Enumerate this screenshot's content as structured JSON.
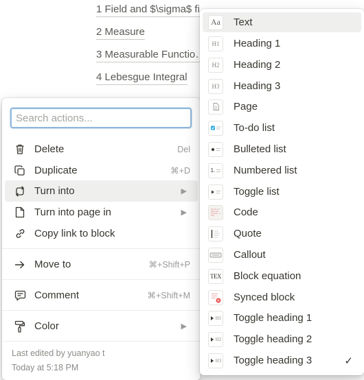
{
  "document": {
    "links": [
      "1 Field and $\\sigma$ fi…",
      "2 Measure",
      "3 Measurable Functio…",
      "4 Lebesgue Integral"
    ]
  },
  "action_menu": {
    "search_placeholder": "Search actions...",
    "items": [
      {
        "label": "Delete",
        "shortcut": "Del",
        "icon": "trash-icon"
      },
      {
        "label": "Duplicate",
        "shortcut": "⌘+D",
        "icon": "duplicate-icon"
      },
      {
        "label": "Turn into",
        "arrow": "▶",
        "icon": "turn-into-icon"
      },
      {
        "label": "Turn into page in",
        "arrow": "▶",
        "icon": "page-icon"
      },
      {
        "label": "Copy link to block",
        "icon": "link-icon"
      },
      {
        "label": "Move to",
        "shortcut": "⌘+Shift+P",
        "icon": "move-arrow-icon"
      },
      {
        "label": "Comment",
        "shortcut": "⌘+Shift+M",
        "icon": "comment-icon"
      },
      {
        "label": "Color",
        "arrow": "▶",
        "icon": "paint-roller-icon"
      }
    ],
    "footer": {
      "edited_by": "Last edited by yuanyao t",
      "edited_at": "Today at 5:18 PM"
    }
  },
  "turn_into_menu": {
    "items": [
      {
        "label": "Text",
        "icon": "text-icon",
        "glyph": "Aa"
      },
      {
        "label": "Heading 1",
        "icon": "heading1-icon",
        "glyph": "H1"
      },
      {
        "label": "Heading 2",
        "icon": "heading2-icon",
        "glyph": "H2"
      },
      {
        "label": "Heading 3",
        "icon": "heading3-icon",
        "glyph": "H3"
      },
      {
        "label": "Page",
        "icon": "page-icon"
      },
      {
        "label": "To-do list",
        "icon": "todo-icon"
      },
      {
        "label": "Bulleted list",
        "icon": "bulleted-list-icon"
      },
      {
        "label": "Numbered list",
        "icon": "numbered-list-icon",
        "glyph": "1."
      },
      {
        "label": "Toggle list",
        "icon": "toggle-list-icon"
      },
      {
        "label": "Code",
        "icon": "code-icon"
      },
      {
        "label": "Quote",
        "icon": "quote-icon"
      },
      {
        "label": "Callout",
        "icon": "callout-icon"
      },
      {
        "label": "Block equation",
        "icon": "equation-icon",
        "glyph": "TEX"
      },
      {
        "label": "Synced block",
        "icon": "synced-block-icon"
      },
      {
        "label": "Toggle heading 1",
        "icon": "toggle-heading1-icon",
        "glyph": "H1"
      },
      {
        "label": "Toggle heading 2",
        "icon": "toggle-heading2-icon",
        "glyph": "H2"
      },
      {
        "label": "Toggle heading 3",
        "icon": "toggle-heading3-icon",
        "glyph": "H3"
      }
    ],
    "selected_check": "✓"
  },
  "colors": {
    "hover_bg": "#efefee",
    "search_focus": "#8fb7dc",
    "todo_blue": "#2eaadc",
    "synced_red": "#eb5757"
  }
}
